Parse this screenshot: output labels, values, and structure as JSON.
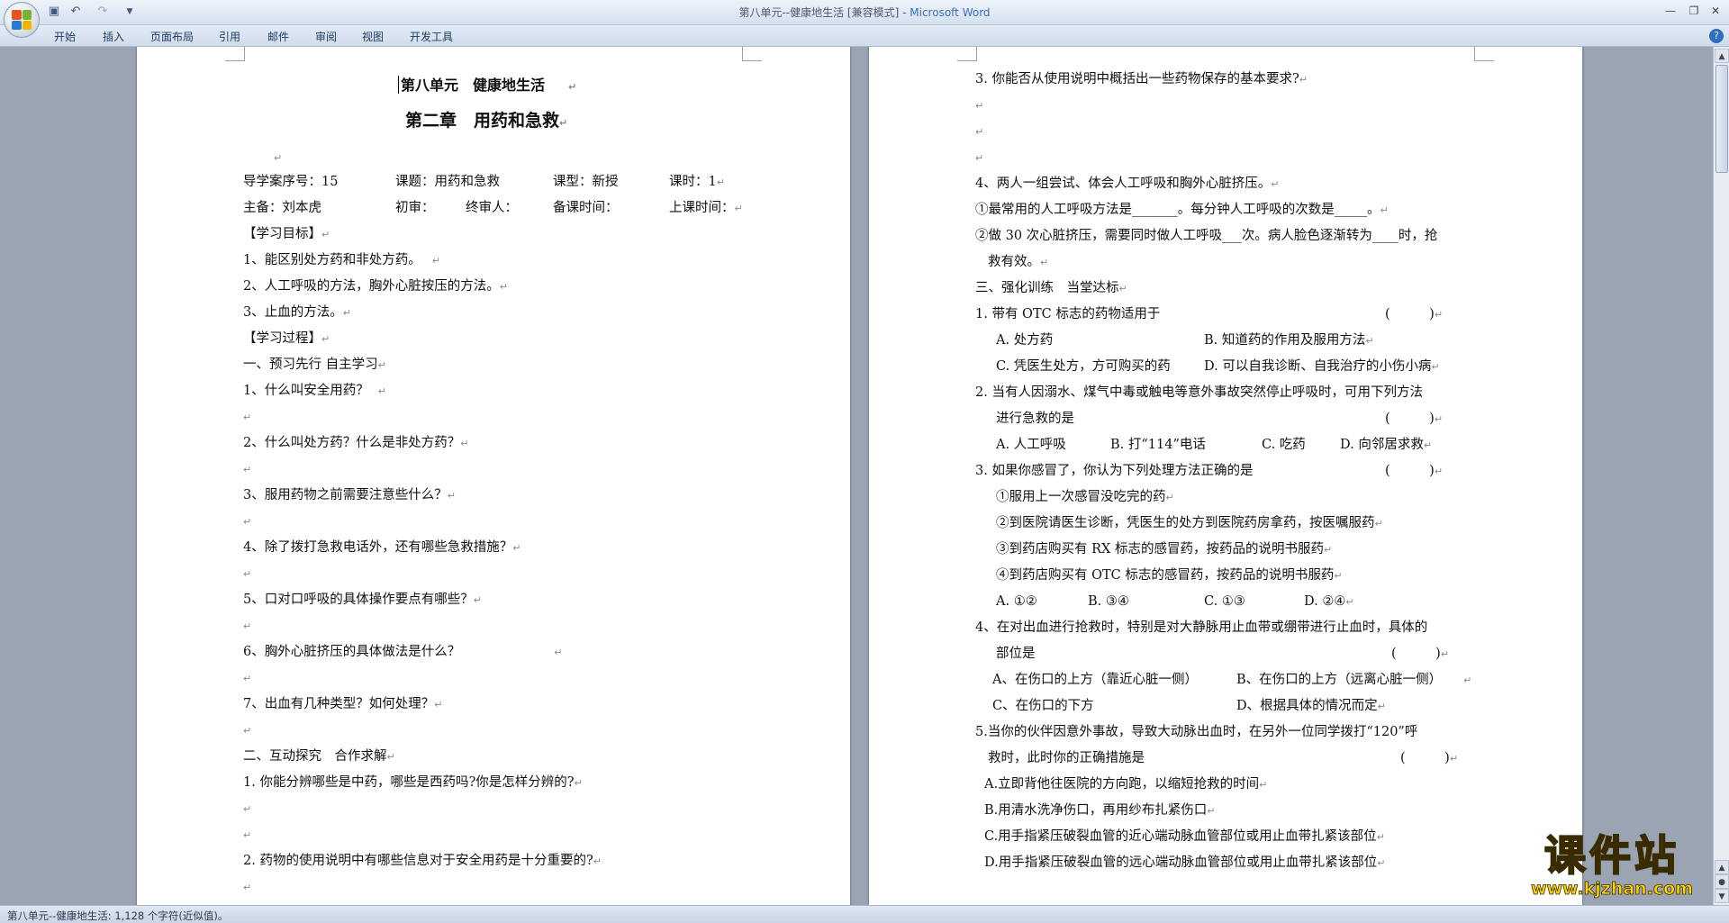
{
  "window": {
    "title_doc": "第八单元--健康地生活 [兼容模式] - ",
    "title_app": "Microsoft Word"
  },
  "quick_access": {
    "save_icon": "save-icon",
    "undo_icon": "undo-icon",
    "redo_icon": "redo-icon",
    "customize_icon": "dropdown-icon"
  },
  "ribbon": {
    "tabs": [
      "开始",
      "插入",
      "页面布局",
      "引用",
      "邮件",
      "审阅",
      "视图",
      "开发工具"
    ],
    "help": "?"
  },
  "page1": {
    "lines": [
      "第八单元　健康地生活",
      "第二章　用药和急救",
      "",
      "导学案序号：15",
      "课题：用药和急救",
      "课型：新授",
      "课时：1",
      "主备：刘本虎",
      "初审：",
      "终审人：",
      "备课时间：",
      "上课时间：",
      "【学习目标】",
      "1、能区别处方药和非处方药。",
      "2、人工呼吸的方法，胸外心脏按压的方法。",
      "3、止血的方法。",
      "【学习过程】",
      "一、预习先行 自主学习",
      "1、什么叫安全用药？",
      "",
      "2、什么叫处方药？什么是非处方药？",
      "",
      "3、服用药物之前需要注意些什么？",
      "",
      "4、除了拨打急救电话外，还有哪些急救措施？",
      "",
      "5、口对口呼吸的具体操作要点有哪些？",
      "",
      "6、胸外心脏挤压的具体做法是什么？",
      "",
      "7、出血有几种类型？如何处理？",
      "",
      "二、互动探究　合作求解",
      "1. 你能分辨哪些是中药，哪些是西药吗?你是怎样分辨的?",
      "",
      "",
      "2. 药物的使用说明中有哪些信息对于安全用药是十分重要的?",
      ""
    ]
  },
  "page2": {
    "lines": [
      "3. 你能否从使用说明中概括出一些药物保存的基本要求?",
      "",
      "",
      "",
      "4、两人一组尝试、体会人工呼吸和胸外心脏挤压。",
      "①最常用的人工呼吸方法是_______。每分钟人工呼吸的次数是_____。",
      "②做 30 次心脏挤压，需要同时做人工呼吸___次。病人脸色逐渐转为____时，抢",
      "救有效。",
      "三、强化训练　当堂达标",
      "1. 带有 OTC 标志的药物适用于",
      "A. 处方药",
      "B. 知道药的作用及服用方法",
      "C. 凭医生处方，方可购买的药",
      "D. 可以自我诊断、自我治疗的小伤小病",
      "2. 当有人因溺水、煤气中毒或触电等意外事故突然停止呼吸时，可用下列方法",
      "进行急救的是",
      "A. 人工呼吸",
      "B. 打“114”电话",
      "C. 吃药",
      "D. 向邻居求救",
      "3. 如果你感冒了，你认为下列处理方法正确的是",
      "①服用上一次感冒没吃完的药",
      "②到医院请医生诊断，凭医生的处方到医院药房拿药，按医嘱服药",
      "③到药店购买有 RX 标志的感冒药，按药品的说明书服药",
      "④到药店购买有 OTC 标志的感冒药，按药品的说明书服药",
      "A. ①②",
      "B. ③④",
      "C. ①③",
      "D. ②④",
      "4、在对出血进行抢救时，特别是对大静脉用止血带或绷带进行止血时，具体的",
      "部位是",
      "A、在伤口的上方（靠近心脏一侧）",
      "B、在伤口的上方（远离心脏一侧）",
      "C、在伤口的下方",
      "D、根据具体的情况而定",
      "5.当你的伙伴因意外事故，导致大动脉出血时，在另外一位同学拨打“120”呼",
      "救时，此时你的正确措施是",
      "A.立即背他往医院的方向跑，以缩短抢救的时间",
      "B.用清水洗净伤口，再用纱布扎紧伤口",
      "C.用手指紧压破裂血管的近心端动脉血管部位或用止血带扎紧该部位",
      "D.用手指紧压破裂血管的远心端动脉血管部位或用止血带扎紧该部位"
    ],
    "answer_bracket": "(　　　)"
  },
  "statusbar": {
    "text": "第八单元--健康地生活: 1,128 个字符(近似值)。"
  },
  "watermark": {
    "cn": "课件站",
    "en": "www.kjzhan.com"
  }
}
